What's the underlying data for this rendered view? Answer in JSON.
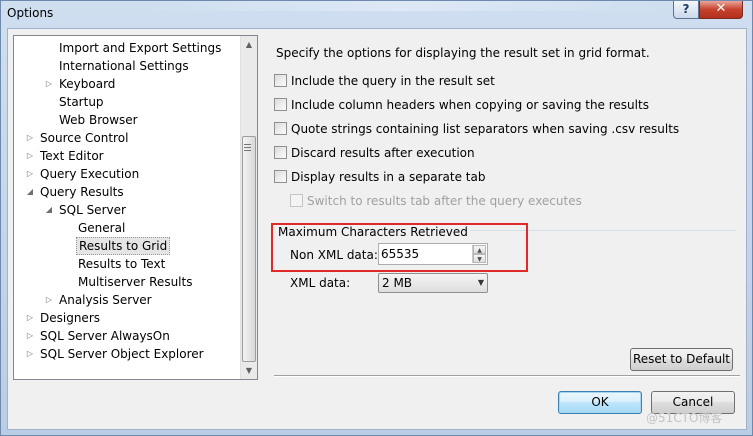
{
  "window": {
    "title": "Options",
    "help_label": "?",
    "close_label": "✕"
  },
  "tree": {
    "items": [
      {
        "label": "Import and Export Settings",
        "indent": 2,
        "arrow": ""
      },
      {
        "label": "International Settings",
        "indent": 2,
        "arrow": ""
      },
      {
        "label": "Keyboard",
        "indent": 2,
        "arrow": "▷"
      },
      {
        "label": "Startup",
        "indent": 2,
        "arrow": ""
      },
      {
        "label": "Web Browser",
        "indent": 2,
        "arrow": ""
      },
      {
        "label": "Source Control",
        "indent": 1,
        "arrow": "▷"
      },
      {
        "label": "Text Editor",
        "indent": 1,
        "arrow": "▷"
      },
      {
        "label": "Query Execution",
        "indent": 1,
        "arrow": "▷"
      },
      {
        "label": "Query Results",
        "indent": 1,
        "arrow": "◢"
      },
      {
        "label": "SQL Server",
        "indent": 2,
        "arrow": "◢"
      },
      {
        "label": "General",
        "indent": 3,
        "arrow": ""
      },
      {
        "label": "Results to Grid",
        "indent": 3,
        "arrow": "",
        "selected": true
      },
      {
        "label": "Results to Text",
        "indent": 3,
        "arrow": ""
      },
      {
        "label": "Multiserver Results",
        "indent": 3,
        "arrow": ""
      },
      {
        "label": "Analysis Server",
        "indent": 2,
        "arrow": "▷"
      },
      {
        "label": "Designers",
        "indent": 1,
        "arrow": "▷"
      },
      {
        "label": "SQL Server AlwaysOn",
        "indent": 1,
        "arrow": "▷"
      },
      {
        "label": "SQL Server Object Explorer",
        "indent": 1,
        "arrow": "▷"
      }
    ],
    "scroll_up": "▲",
    "scroll_down": "▼"
  },
  "main": {
    "description": "Specify the options for displaying the result set in grid format.",
    "options": [
      {
        "label": "Include the query in the result set",
        "checked": false,
        "enabled": true
      },
      {
        "label": "Include column headers when copying or saving the results",
        "checked": false,
        "enabled": true
      },
      {
        "label": "Quote strings containing list separators when saving .csv results",
        "checked": false,
        "enabled": true
      },
      {
        "label": "Discard results after execution",
        "checked": false,
        "enabled": true
      },
      {
        "label": "Display results in a separate tab",
        "checked": false,
        "enabled": true
      },
      {
        "label": "Switch to results tab after the query executes",
        "checked": false,
        "enabled": false
      }
    ],
    "max_chars_group": "Maximum Characters Retrieved",
    "non_xml_label": "Non XML data:",
    "non_xml_value": "65535",
    "xml_label": "XML data:",
    "xml_value": "2 MB",
    "reset_label": "Reset to Default"
  },
  "footer": {
    "ok_label": "OK",
    "cancel_label": "Cancel"
  },
  "watermark": "@51CTO博客"
}
